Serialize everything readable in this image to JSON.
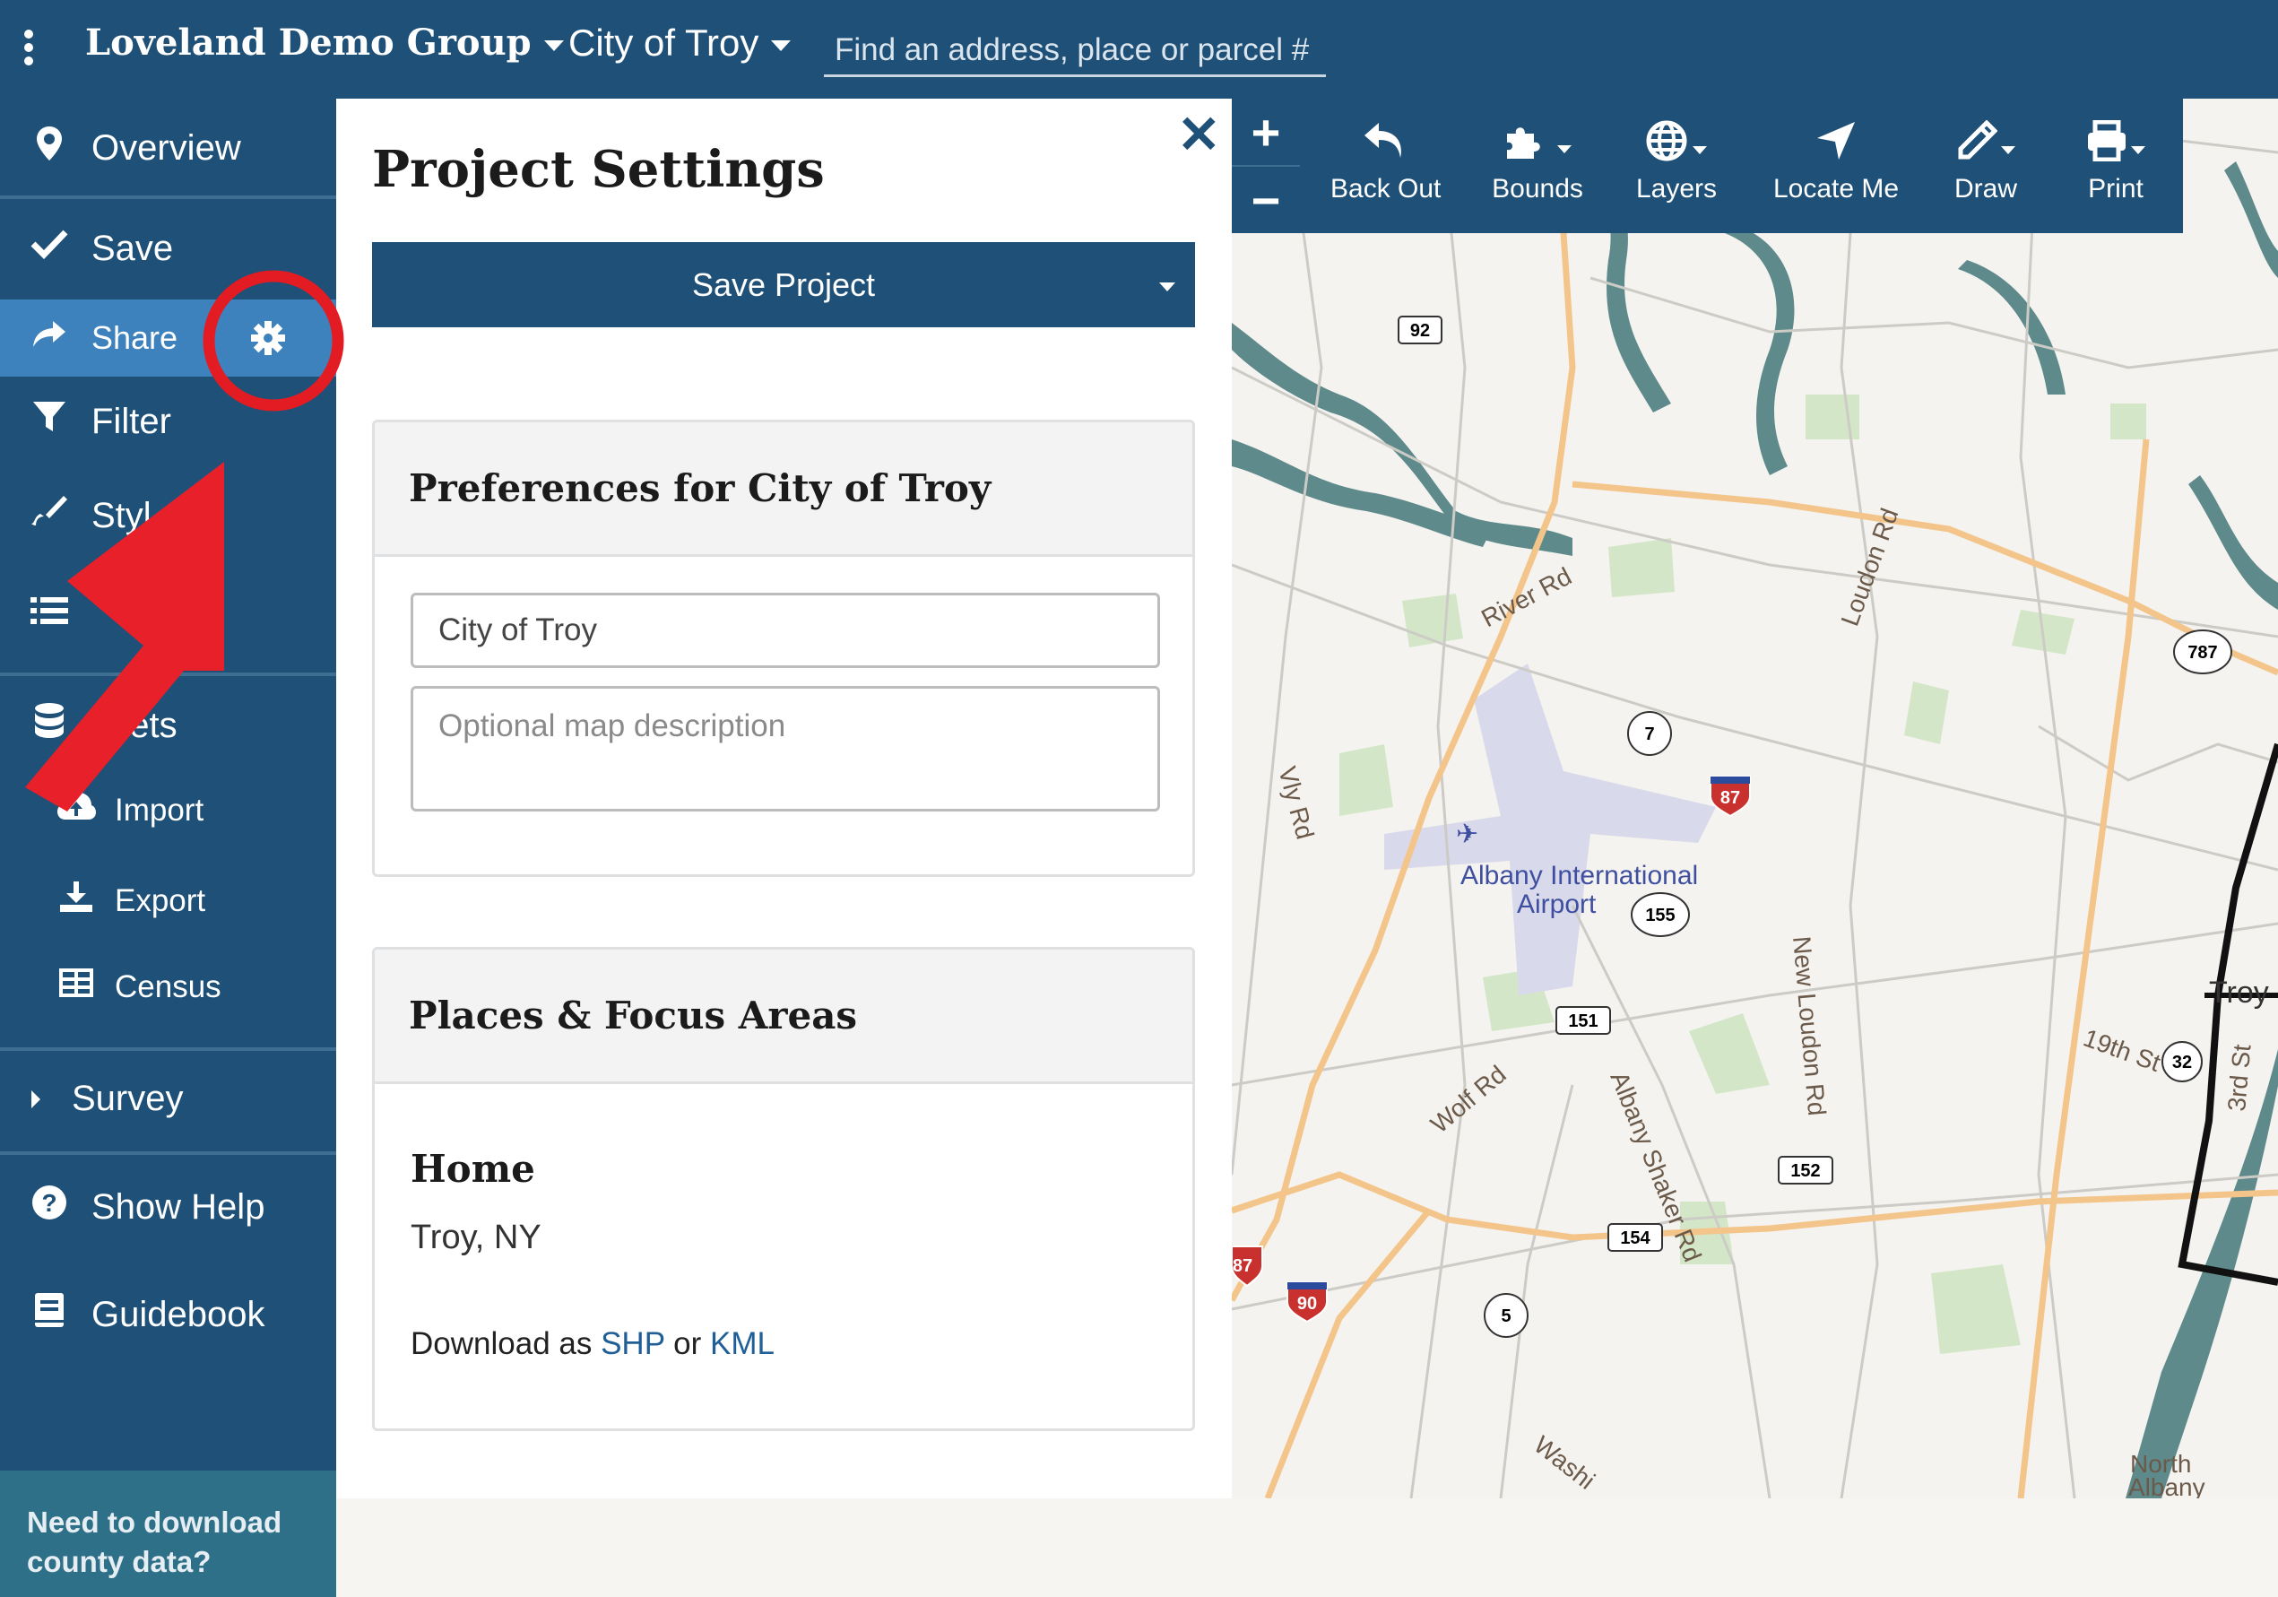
{
  "header": {
    "menu_icon": "kebab-menu-icon",
    "group_label": "Loveland Demo Group",
    "region_label": "City of Troy",
    "search_placeholder": "Find an address, place or parcel #"
  },
  "sidebar": {
    "items": {
      "overview": "Overview",
      "save": "Save",
      "share": "Share",
      "filter": "Filter",
      "style": "Styl",
      "list": "",
      "datasets": "asets",
      "import": "Import",
      "export": "Export",
      "census": "Census",
      "survey": "Survey",
      "help": "Show Help",
      "guidebook": "Guidebook"
    },
    "cta": "Need to download county data?"
  },
  "panel": {
    "title": "Project Settings",
    "save_button": "Save Project",
    "preferences": {
      "heading": "Preferences for City of Troy",
      "name_value": "City of Troy",
      "description_placeholder": "Optional map description"
    },
    "places": {
      "heading": "Places & Focus Areas",
      "home_title": "Home",
      "home_location": "Troy, NY",
      "download_prefix": "Download as",
      "download_shp": "SHP",
      "download_or": "or",
      "download_kml": "KML"
    }
  },
  "map": {
    "toolbar": {
      "zoom_in": "+",
      "zoom_out": "−",
      "back_out": "Back Out",
      "bounds": "Bounds",
      "layers": "Layers",
      "locate_me": "Locate Me",
      "draw": "Draw",
      "print": "Print"
    },
    "labels": {
      "airport": "Albany International",
      "airport2": "Airport",
      "river_rd": "River Rd",
      "loudon_rd": "Loudon Rd",
      "vly_rd": "Vly Rd",
      "new_loudon": "New Loudon Rd",
      "albany_shaker": "Albany Shaker Rd",
      "wolf_rd": "Wolf Rd",
      "nineteenth": "19th St",
      "troy": "Troy",
      "third": "3rd St",
      "north_albany": "North",
      "north_albany2": "Albany",
      "washington": "Washi"
    },
    "shields": {
      "r92": "92",
      "r7": "7",
      "r87a": "87",
      "r155": "155",
      "r151": "151",
      "r152": "152",
      "r154": "154",
      "r5": "5",
      "r90": "90",
      "r87b": "87",
      "r787": "787",
      "r32": "32"
    },
    "colors": {
      "water": "#5f8a8b",
      "park": "#cfe5c3",
      "major_road": "#f5c98a",
      "minor_road": "#c8c8c8",
      "airport": "#d6d8e8",
      "boundary": "#111111"
    }
  },
  "annotations": {
    "highlight_color": "#e31b23",
    "highlighted_icon": "gear-icon"
  }
}
